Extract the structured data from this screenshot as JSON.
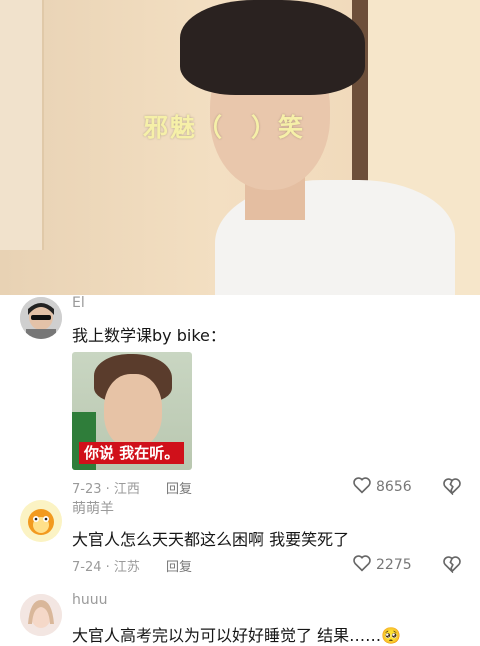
{
  "video": {
    "caption": "邪魅（　）笑"
  },
  "comments": [
    {
      "username": "El",
      "text": "我上数学课by bike：",
      "sticker_text": "你说 我在听。",
      "meta": "7-23 · 江西",
      "reply_label": "回复",
      "likes": "8656"
    },
    {
      "username": "萌萌羊",
      "text": "大官人怎么天天都这么困啊 我要笑死了",
      "meta": "7-24 · 江苏",
      "reply_label": "回复",
      "likes": "2275"
    },
    {
      "username": "huuu",
      "text": "大官人高考完以为可以好好睡觉了 结果……",
      "emoji": "🥺"
    }
  ],
  "icons": {
    "like": "heart-outline-icon",
    "dislike": "broken-heart-icon"
  }
}
